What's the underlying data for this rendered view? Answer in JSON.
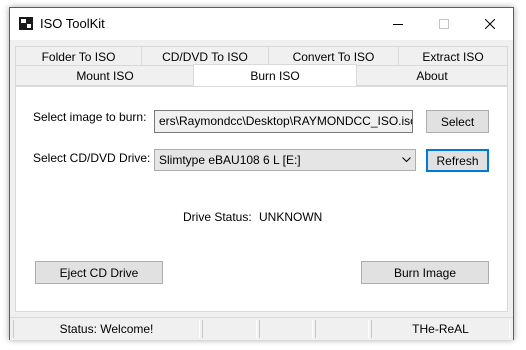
{
  "window": {
    "title": "ISO ToolKit",
    "controls": {
      "minimize_icon": "minimize-icon",
      "maximize_icon": "maximize-icon",
      "close_icon": "close-icon"
    }
  },
  "tabs_row1": [
    {
      "label": "Folder To ISO"
    },
    {
      "label": "CD/DVD To ISO"
    },
    {
      "label": "Convert To ISO"
    },
    {
      "label": "Extract ISO"
    }
  ],
  "tabs_row2": [
    {
      "label": "Mount ISO"
    },
    {
      "label": "Burn ISO",
      "active": true
    },
    {
      "label": "About"
    }
  ],
  "burn": {
    "image_label": "Select image to burn:",
    "image_value": "ers\\Raymondcc\\Desktop\\RAYMONDCC_ISO.iso",
    "select_button": "Select",
    "drive_label": "Select CD/DVD Drive:",
    "drive_value": "Slimtype eBAU108  6 L [E:]",
    "refresh_button": "Refresh",
    "status_label": "Drive Status:",
    "status_value": "UNKNOWN",
    "eject_button": "Eject CD Drive",
    "burn_button": "Burn Image"
  },
  "statusbar": {
    "status": "Status: Welcome!",
    "right": "THe-ReAL"
  }
}
